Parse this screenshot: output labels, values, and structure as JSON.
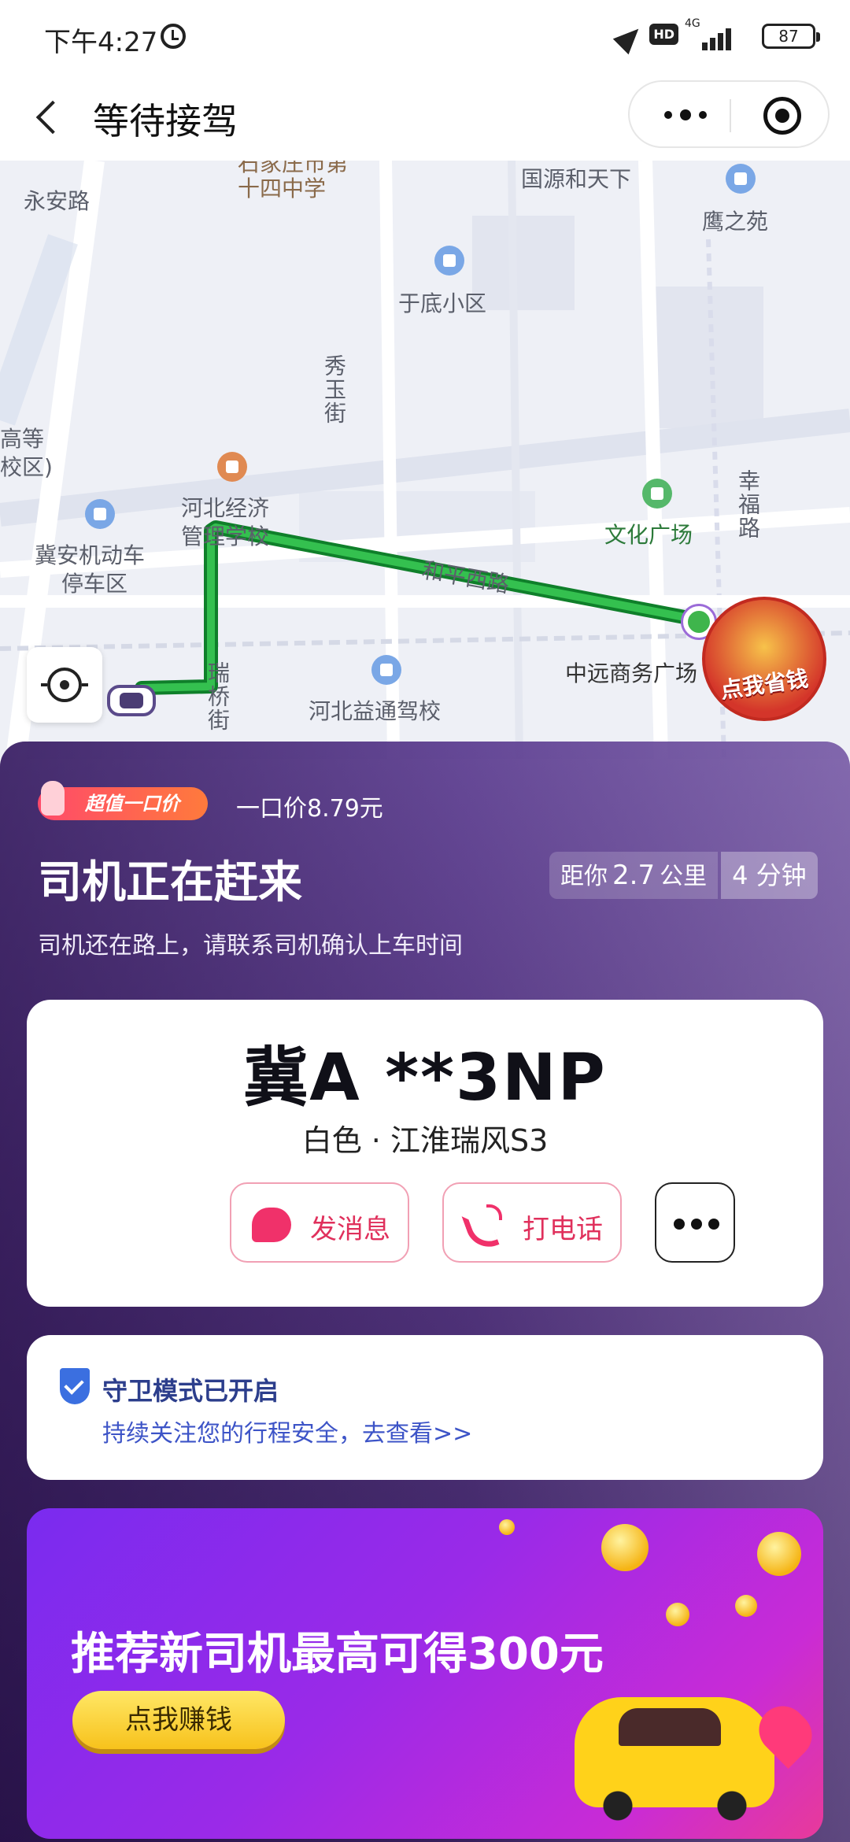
{
  "status_bar": {
    "time": "下午4:27",
    "network": "4G",
    "hd_label": "HD",
    "battery": "87",
    "icons": [
      "alarm-icon",
      "location-arrow-icon",
      "hd-icon",
      "signal-icon",
      "battery-icon"
    ]
  },
  "nav": {
    "title": "等待接驾",
    "back_icon": "chevron-left-icon",
    "more_icon": "more-icon",
    "close_icon": "close-target-icon"
  },
  "map": {
    "labels": {
      "school": "十四中学",
      "school_top": "石家庄市第",
      "yongan_road": "永安路",
      "guoyuan": "国源和天下",
      "yingzhiyuan": "鹰之苑",
      "yudi": "于底小区",
      "xiuyu_street": "秀玉街",
      "hebei_jingji": "河北经济",
      "hebei_jingji_2": "管理学校",
      "jian_parking": "冀安机动车",
      "jian_parking_2": "停车区",
      "wenhua_square": "文化广场",
      "xingfu_road": "幸福路",
      "heping_west": "和平西路",
      "zhongyuan": "中远商务广场",
      "ruiqiao_street": "瑞桥街",
      "yitong": "河北益通驾校",
      "gaodeng": "高等",
      "jiaoqu": "校区)"
    },
    "save_money_badge": "点我省钱"
  },
  "panel": {
    "price_badge": "超值一口价",
    "price_text": "一口价8.79元",
    "title": "司机正在赶来",
    "subtitle": "司机还在路上，请联系司机确认上车时间",
    "distance_prefix": "距你",
    "distance_value": "2.7",
    "distance_unit": "公里",
    "eta": "4 分钟"
  },
  "driver": {
    "plate": "冀A **3NP",
    "car_model": "白色 · 江淮瑞风S3",
    "message_label": "发消息",
    "call_label": "打电话"
  },
  "guard": {
    "title": "守卫模式已开启",
    "link": "持续关注您的行程安全，去查看>>"
  },
  "promo": {
    "title": "推荐新司机最高可得300元",
    "button": "点我赚钱"
  },
  "colors": {
    "route": "#1f9e3a",
    "accent_pink": "#e0305c",
    "panel_purple": "#54348a",
    "guard_blue": "#3d54c7",
    "promo_yellow": "#f7c21c"
  }
}
